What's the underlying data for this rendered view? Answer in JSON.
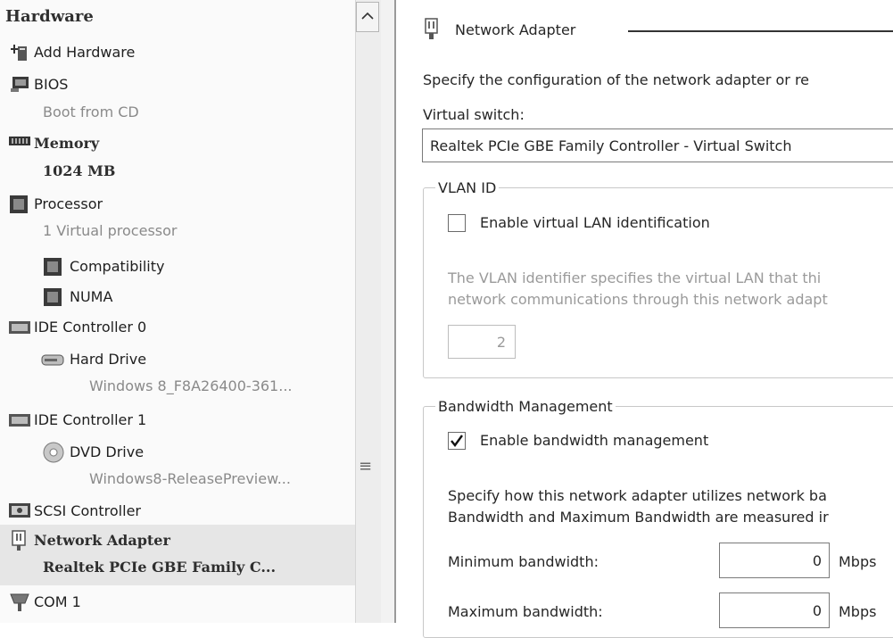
{
  "sidebar": {
    "header": "Hardware",
    "items": [
      {
        "label": "Add Hardware",
        "icon": "add-hardware-icon"
      },
      {
        "label": "BIOS",
        "sub": "Boot from CD",
        "icon": "bios-icon"
      },
      {
        "label": "Memory",
        "sub": "1024 MB",
        "icon": "memory-icon"
      },
      {
        "label": "Processor",
        "sub": "1 Virtual processor",
        "icon": "processor-icon"
      },
      {
        "label": "Compatibility",
        "icon": "chip-icon"
      },
      {
        "label": "NUMA",
        "icon": "chip-icon"
      },
      {
        "label": "IDE Controller 0",
        "icon": "ide-controller-icon"
      },
      {
        "label": "Hard Drive",
        "sub": "Windows 8_F8A26400-361...",
        "icon": "hard-drive-icon"
      },
      {
        "label": "IDE Controller 1",
        "icon": "ide-controller-icon"
      },
      {
        "label": "DVD Drive",
        "sub": "Windows8-ReleasePreview...",
        "icon": "dvd-icon"
      },
      {
        "label": "SCSI Controller",
        "icon": "scsi-icon"
      },
      {
        "label": "Network Adapter",
        "sub": "Realtek PCIe GBE Family C...",
        "icon": "network-adapter-icon"
      },
      {
        "label": "COM 1",
        "icon": "com-port-icon"
      }
    ]
  },
  "scroll": {
    "up": "^",
    "grip": "≡"
  },
  "panel": {
    "title": "Network Adapter",
    "description": "Specify the configuration of the network adapter or re",
    "switch_label": "Virtual switch:",
    "switch_value": "Realtek PCIe GBE Family Controller - Virtual Switch",
    "vlan": {
      "legend": "VLAN ID",
      "checkbox_label": "Enable virtual LAN identification",
      "checked": false,
      "help_line1": "The VLAN identifier specifies the virtual LAN that thi",
      "help_line2": "network communications through this network adapt",
      "value": "2"
    },
    "bandwidth": {
      "legend": "Bandwidth Management",
      "checkbox_label": "Enable bandwidth management",
      "checked": true,
      "help_line1": "Specify how this network adapter utilizes network ba",
      "help_line2": "Bandwidth and Maximum Bandwidth are measured ir",
      "min_label": "Minimum bandwidth:",
      "min_value": "0",
      "max_label": "Maximum bandwidth:",
      "max_value": "0",
      "unit": "Mbps"
    }
  },
  "colors": {
    "selection": "#e6e6e6",
    "separator": "#9a9a9a"
  }
}
